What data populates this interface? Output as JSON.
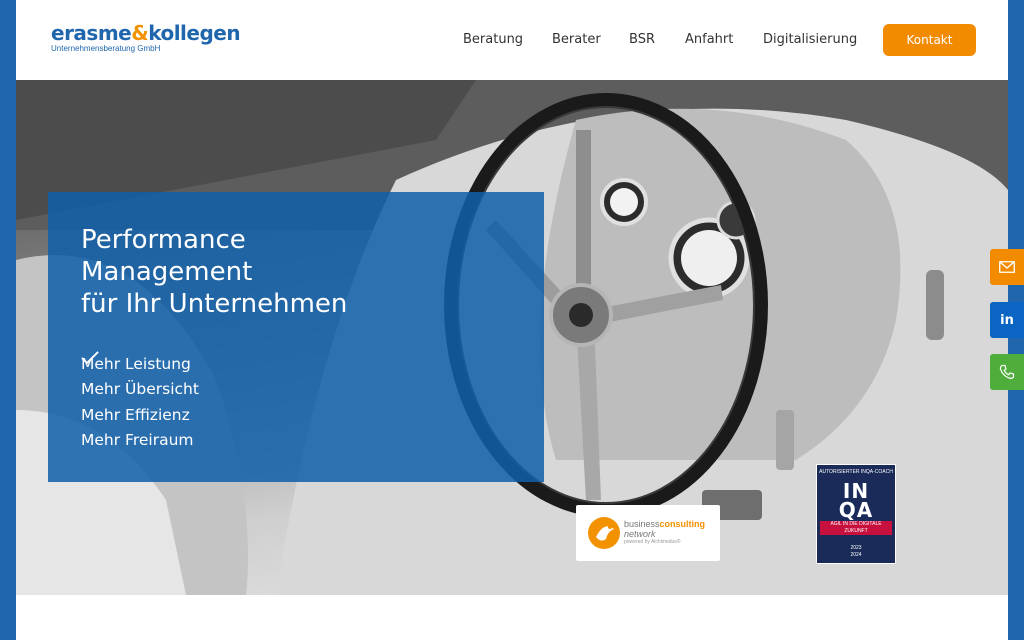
{
  "header": {
    "logo": {
      "name_part1": "erasme",
      "name_amp": "&",
      "name_part2": "kollegen",
      "subtitle": "Unternehmensberatung GmbH"
    },
    "nav": [
      {
        "label": "Beratung"
      },
      {
        "label": "Berater"
      },
      {
        "label": "BSR"
      },
      {
        "label": "Anfahrt"
      },
      {
        "label": "Digitalisierung"
      }
    ],
    "contact_button": "Kontakt"
  },
  "hero": {
    "title_lines": [
      "Performance",
      "Management",
      "für Ihr Unternehmen"
    ],
    "benefits": [
      "Mehr Leistung",
      "Mehr Übersicht",
      "Mehr Effizienz",
      "Mehr Freiraum"
    ]
  },
  "badges": {
    "bcn": {
      "line1_a": "business",
      "line1_b": "consulting",
      "line2": "network",
      "line3": "powered by Alchimedus®"
    },
    "inqa": {
      "top": "AUTORISIERTER INQA-COACH",
      "logo_top": "IN",
      "logo_bottom": "QA",
      "ribbon": "AGIL IN DIE DIGITALE ZUKUNFT",
      "year1": "2023",
      "year2": "2024"
    }
  },
  "side_buttons": {
    "mail_icon": "mail-icon",
    "linkedin_label": "in",
    "phone_icon": "phone-icon"
  },
  "colors": {
    "brand_blue": "#1f66ad",
    "accent_orange": "#f28b00",
    "linkedin_blue": "#0a66c2",
    "phone_green": "#4fae3b"
  }
}
